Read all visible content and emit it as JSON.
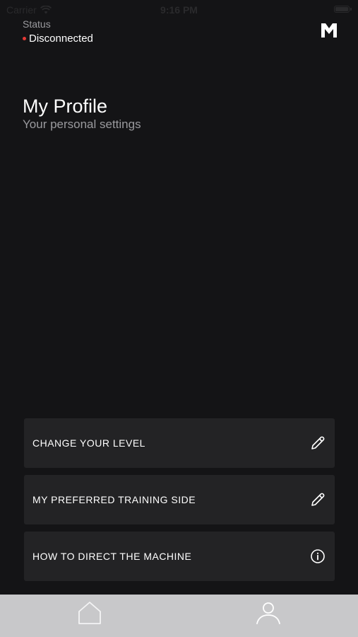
{
  "status_bar": {
    "carrier": "Carrier",
    "time": "9:16 PM"
  },
  "connection": {
    "label": "Status",
    "value": "Disconnected",
    "dot_color": "#e53935"
  },
  "logo": {
    "icon": "brand-m-logo-icon"
  },
  "header": {
    "title": "My Profile",
    "subtitle": "Your personal settings"
  },
  "menu": {
    "items": [
      {
        "label": "CHANGE YOUR LEVEL",
        "icon": "pencil-icon"
      },
      {
        "label": "MY PREFERRED TRAINING SIDE",
        "icon": "pencil-icon"
      },
      {
        "label": "HOW TO DIRECT THE MACHINE",
        "icon": "info-icon"
      }
    ]
  },
  "tab_bar": {
    "tabs": [
      {
        "icon": "home-icon",
        "active": false
      },
      {
        "icon": "user-icon",
        "active": true
      }
    ],
    "background": "#c8c8ca"
  }
}
